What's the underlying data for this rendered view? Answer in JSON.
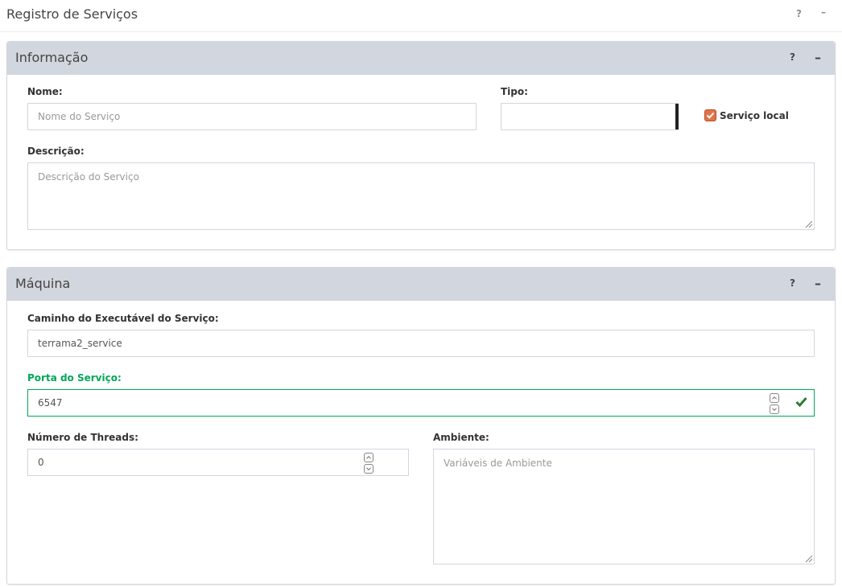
{
  "page": {
    "title": "Registro de Serviços",
    "help_label": "?",
    "collapse_label": "–"
  },
  "info_box": {
    "title": "Informação",
    "help_label": "?",
    "collapse_label": "–",
    "name": {
      "label": "Nome:",
      "placeholder": "Nome do Serviço",
      "value": ""
    },
    "type": {
      "label": "Tipo:",
      "selected": ""
    },
    "local_service": {
      "label": "Serviço local",
      "checked": true
    },
    "description": {
      "label": "Descrição:",
      "placeholder": "Descrição do Serviço",
      "value": ""
    }
  },
  "machine_box": {
    "title": "Máquina",
    "help_label": "?",
    "collapse_label": "–",
    "exec_path": {
      "label": "Caminho do Executável do Serviço:",
      "value": "terrama2_service"
    },
    "port": {
      "label": "Porta do Serviço:",
      "value": "6547",
      "status": "valid"
    },
    "threads": {
      "label": "Número de Threads:",
      "value": "0"
    },
    "environment": {
      "label": "Ambiente:",
      "placeholder": "Variáveis de Ambiente",
      "value": ""
    }
  },
  "colors": {
    "valid": "#00a65a",
    "checkbox": "#e0734a",
    "box_header": "#d2d6de",
    "check_icon": "#2e7d32"
  },
  "icons": {
    "help": "help-icon",
    "collapse": "minus-icon",
    "valid": "checkmark-icon",
    "checkbox": "checkbox-checked-icon"
  }
}
